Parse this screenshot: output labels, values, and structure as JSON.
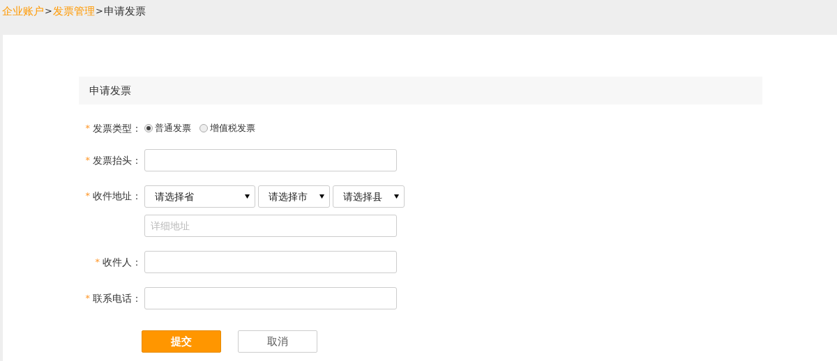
{
  "breadcrumb": [
    {
      "label": "企业账户",
      "kind": "link"
    },
    {
      "label": ">",
      "kind": "separator"
    },
    {
      "label": "发票管理",
      "kind": "link"
    },
    {
      "label": ">",
      "kind": "separator"
    },
    {
      "label": "申请发票",
      "kind": "current"
    }
  ],
  "section_title": "申请发票",
  "form": [
    {
      "kind": "radio",
      "required_mark": "*",
      "label": "发票类型：",
      "options": [
        {
          "label": "普通发票",
          "selected": true
        },
        {
          "label": "增值税发票",
          "selected": false
        }
      ]
    },
    {
      "kind": "text",
      "required_mark": "*",
      "label": "发票抬头："
    },
    {
      "kind": "address",
      "required_mark": "*",
      "label": "收件地址：",
      "selects": [
        {
          "value": "请选择省"
        },
        {
          "value": "请选择市"
        },
        {
          "value": "请选择县"
        }
      ],
      "detail": {
        "placeholder": "详细地址"
      }
    },
    {
      "kind": "text",
      "required_mark": "*",
      "label": "收件人："
    },
    {
      "kind": "text",
      "required_mark": "*",
      "label": "联系电话："
    }
  ],
  "buttons": [
    {
      "label": "提交",
      "kind": "primary"
    },
    {
      "label": "取消",
      "kind": "secondary"
    }
  ]
}
